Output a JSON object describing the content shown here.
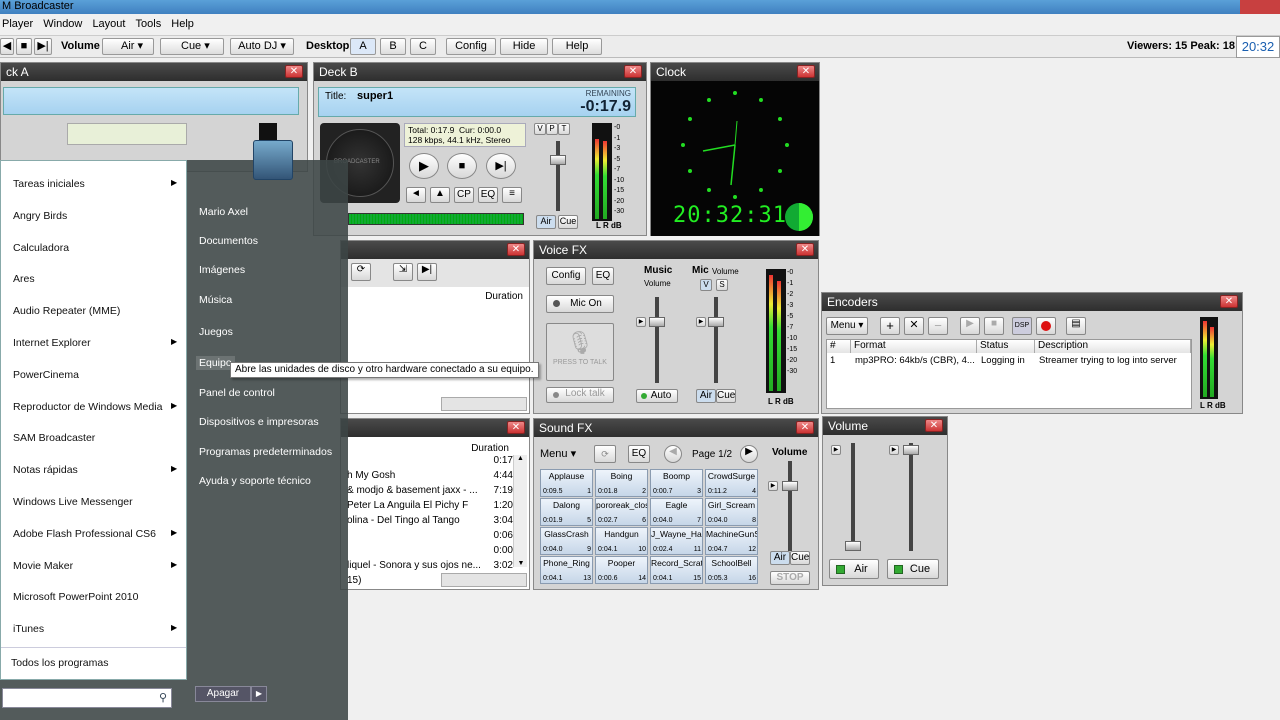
{
  "app": {
    "title": "M Broadcaster"
  },
  "menu": [
    "Player",
    "Window",
    "Layout",
    "Tools",
    "Help"
  ],
  "toolbar": {
    "volume_label": "Volume",
    "air": "Air",
    "cue": "Cue",
    "autodj": "Auto DJ",
    "desktop_label": "Desktop",
    "a": "A",
    "b": "B",
    "c": "C",
    "config": "Config",
    "hide": "Hide",
    "help": "Help",
    "viewers": "Viewers: 15  Peak: 18",
    "time": "20:32"
  },
  "deckA": {
    "title": "ck A"
  },
  "deckB": {
    "title": "Deck B",
    "track_label": "Title:",
    "track": "super1",
    "remaining_label": "REMAINING",
    "remaining": "-0:17.9",
    "total": "Total: 0:17.9",
    "cur": "Cur: 0:00.0",
    "info": "128 kbps, 44.1 kHz, Stereo",
    "logo": "BROADCASTER",
    "cp": "CP",
    "eq": "EQ",
    "v": "V",
    "p": "P",
    "t": "T",
    "air": "Air",
    "cue": "Cue",
    "lr": "L R dB",
    "scale": [
      "-0",
      "-1",
      "-3",
      "-5",
      "-7",
      "-10",
      "-15",
      "-20",
      "-30"
    ]
  },
  "clock": {
    "title": "Clock",
    "digital": "20:32:31",
    "lr": "L R dB"
  },
  "playlist": {
    "duration_header": "Duration",
    "rows": [
      {
        "title": "",
        "duration": "0:17"
      },
      {
        "title": "h My Gosh",
        "duration": "4:44"
      },
      {
        "title": "& modjo & basement jaxx - ...",
        "duration": "7:19"
      },
      {
        "title": "Peter La Anguila   El Pichy F",
        "duration": "1:20"
      },
      {
        "title": "olina - Del Tingo al Tango",
        "duration": "3:04"
      },
      {
        "title": "",
        "duration": "0:06"
      },
      {
        "title": "",
        "duration": "0:00"
      },
      {
        "title": "liquel - Sonora y sus ojos ne...",
        "duration": "3:02"
      }
    ],
    "footer": "15)"
  },
  "voicefx": {
    "title": "Voice FX",
    "config": "Config",
    "eq": "EQ",
    "mic_on": "Mic On",
    "press_to_talk": "PRESS TO TALK",
    "lock_talk": "Lock talk",
    "music": "Music",
    "music_vol": "Volume",
    "mic": "Mic",
    "mic_vol": "Volume",
    "v": "V",
    "s": "S",
    "auto": "Auto",
    "air": "Air",
    "cue": "Cue",
    "lr": "L R dB",
    "scale": [
      "-0",
      "-1",
      "-2",
      "-3",
      "-5",
      "-7",
      "-10",
      "-15",
      "-20",
      "-30"
    ]
  },
  "encoders": {
    "title": "Encoders",
    "menu": "Menu",
    "dsp": "DSP",
    "headers": [
      "#",
      "Format",
      "Status",
      "Description"
    ],
    "row": {
      "num": "1",
      "format": "mp3PRO: 64kb/s (CBR), 4...",
      "status": "Logging in",
      "desc": "Streamer trying to log into server"
    },
    "lr": "L R dB"
  },
  "soundfx": {
    "title": "Sound FX",
    "menu": "Menu",
    "eq": "EQ",
    "page": "Page 1/2",
    "volume": "Volume",
    "air": "Air",
    "cue": "Cue",
    "stop": "STOP",
    "pads": [
      {
        "name": "Applause",
        "time": "0:09.5",
        "num": "1"
      },
      {
        "name": "Boing",
        "time": "0:01.8",
        "num": "2"
      },
      {
        "name": "Boomp",
        "time": "0:00.7",
        "num": "3"
      },
      {
        "name": "CrowdSurge",
        "time": "0:11.2",
        "num": "4"
      },
      {
        "name": "Dalong",
        "time": "0:01.9",
        "num": "5"
      },
      {
        "name": "pororeak_closi",
        "time": "0:02.7",
        "num": "6"
      },
      {
        "name": "Eagle",
        "time": "0:04.0",
        "num": "7"
      },
      {
        "name": "Girl_Scream",
        "time": "0:04.0",
        "num": "8"
      },
      {
        "name": "GlassCrash",
        "time": "0:04.0",
        "num": "9"
      },
      {
        "name": "Handgun",
        "time": "0:04.1",
        "num": "10"
      },
      {
        "name": "J_Wayne_Habi",
        "time": "0:02.4",
        "num": "11"
      },
      {
        "name": "MachineGunShe",
        "time": "0:04.7",
        "num": "12"
      },
      {
        "name": "Phone_Ring",
        "time": "0:04.1",
        "num": "13"
      },
      {
        "name": "Pooper",
        "time": "0:00.6",
        "num": "14"
      },
      {
        "name": "Record_Scratc",
        "time": "0:04.1",
        "num": "15"
      },
      {
        "name": "SchoolBell",
        "time": "0:05.3",
        "num": "16"
      }
    ]
  },
  "volume": {
    "title": "Volume",
    "air": "Air",
    "cue": "Cue"
  },
  "startmenu": {
    "left": [
      {
        "label": "Tareas iniciales",
        "arrow": true
      },
      {
        "label": "Angry Birds",
        "arrow": false
      },
      {
        "label": "Calculadora",
        "arrow": false
      },
      {
        "label": "Ares",
        "arrow": false
      },
      {
        "label": "Audio Repeater (MME)",
        "arrow": false
      },
      {
        "label": "Internet Explorer",
        "arrow": true
      },
      {
        "label": "PowerCinema",
        "arrow": false
      },
      {
        "label": "Reproductor de Windows Media",
        "arrow": true
      },
      {
        "label": "SAM Broadcaster",
        "arrow": false
      },
      {
        "label": "Notas rápidas",
        "arrow": true
      },
      {
        "label": "Windows Live Messenger",
        "arrow": false
      },
      {
        "label": "Adobe Flash Professional CS6",
        "arrow": true
      },
      {
        "label": "Movie Maker",
        "arrow": true
      },
      {
        "label": "Microsoft PowerPoint 2010",
        "arrow": false
      },
      {
        "label": "iTunes",
        "arrow": true
      }
    ],
    "all_programs": "Todos los programas",
    "right": [
      "Mario Axel",
      "Documentos",
      "Imágenes",
      "Música",
      "Juegos",
      "Equipo",
      "Panel de control",
      "Dispositivos e impresoras",
      "Programas predeterminados",
      "Ayuda y soporte técnico"
    ],
    "shutdown": "Apagar",
    "tooltip": "Abre las unidades de disco y otro hardware conectado a su equipo."
  }
}
